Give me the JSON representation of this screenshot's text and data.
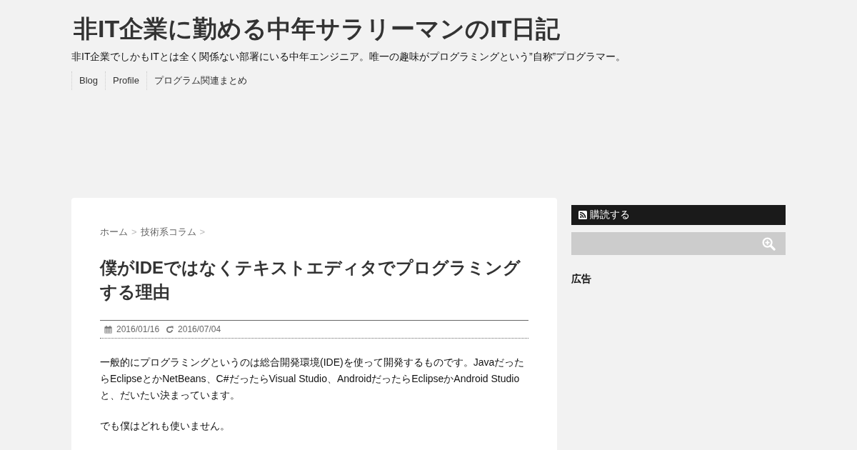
{
  "site": {
    "title": "非IT企業に勤める中年サラリーマンのIT日記",
    "tagline": "非IT企業でしかもITとは全く関係ない部署にいる中年エンジニア。唯一の趣味がプログラミングという”自称”プログラマー。"
  },
  "nav": [
    {
      "label": "Blog"
    },
    {
      "label": "Profile"
    },
    {
      "label": "プログラム関連まとめ"
    }
  ],
  "article": {
    "breadcrumbs": [
      {
        "label": "ホーム",
        "separator": ">"
      },
      {
        "label": "技術系コラム",
        "separator": ">"
      }
    ],
    "title": "僕がIDEではなくテキストエディタでプログラミングする理由",
    "published": "2016/01/16",
    "updated": "2016/07/04",
    "paragraphs": [
      "一般的にプログラミングというのは総合開発環境(IDE)を使って開発するものです。JavaだったらEclipseとかNetBeans、C#だったらVisual Studio、AndroidだったらEclipseかAndroid Studioと、だいたい決まっています。",
      "でも僕はどれも使いません。"
    ]
  },
  "sidebar": {
    "subscribe_button": "購読する",
    "widgets": [
      {
        "title": "広告"
      }
    ]
  }
}
